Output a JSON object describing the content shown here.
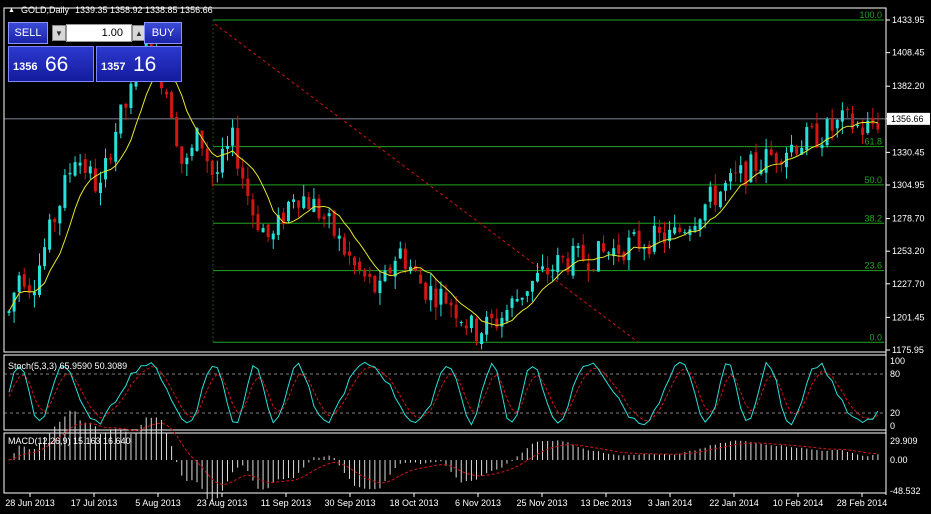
{
  "symbol_header": {
    "title": "GOLD,Daily",
    "ohlc": "1339.35 1358.92 1338.85 1356.66"
  },
  "one_click": {
    "sell_label": "SELL",
    "buy_label": "BUY",
    "lot": "1.00",
    "sell_price_small": "1356",
    "sell_price_big": "66",
    "buy_price_small": "1357",
    "buy_price_big": "16"
  },
  "price_axis": {
    "ticks": [
      "1433.95",
      "1408.45",
      "1382.20",
      "1356.66",
      "1330.45",
      "1304.95",
      "1278.70",
      "1253.20",
      "1227.70",
      "1201.45",
      "1175.95"
    ],
    "current_price": "1356.66"
  },
  "fibonacci": {
    "levels": [
      "100.0",
      "61.8",
      "50.0",
      "38.2",
      "23.6",
      "0.0"
    ]
  },
  "stochastic": {
    "label": "Stoch(5,3,3) 65.9590 50.3089",
    "scale": [
      "100",
      "80",
      "20",
      "0"
    ]
  },
  "macd": {
    "label": "MACD(12,26,9) 15.163 16.640",
    "scale": [
      "29.909",
      "0.00",
      "-48.532"
    ]
  },
  "time_axis": {
    "labels": [
      "28 Jun 2013",
      "17 Jul 2013",
      "5 Aug 2013",
      "23 Aug 2013",
      "11 Sep 2013",
      "30 Sep 2013",
      "18 Oct 2013",
      "6 Nov 2013",
      "25 Nov 2013",
      "13 Dec 2013",
      "3 Jan 2014",
      "22 Jan 2014",
      "10 Feb 2014",
      "28 Feb 2014"
    ]
  },
  "colors": {
    "bull": "#27e0d8",
    "bear": "#d21515",
    "ma": "#e6e62e",
    "fib": "#1fa51f",
    "trend": "#d21515",
    "grid": "#ffffff",
    "stoch_main": "#27e0d8",
    "stoch_signal": "#d21515"
  }
}
